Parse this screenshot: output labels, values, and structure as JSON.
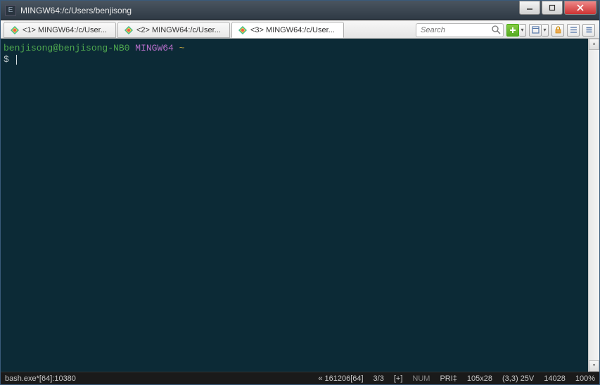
{
  "window": {
    "title": "MINGW64:/c/Users/benjisong"
  },
  "tabs": [
    {
      "label": "<1> MINGW64:/c/User...",
      "active": false
    },
    {
      "label": "<2> MINGW64:/c/User...",
      "active": false
    },
    {
      "label": "<3> MINGW64:/c/User...",
      "active": true
    }
  ],
  "search": {
    "placeholder": "Search"
  },
  "terminal": {
    "prompt_user_host": "benjisong@benjisong-NB0",
    "prompt_env": "MINGW64",
    "prompt_path": "~",
    "prompt_symbol": "$"
  },
  "statusbar": {
    "process": "bash.exe*[64]:10380",
    "encoding": "« 161206[64]",
    "screens": "3/3",
    "plus": "[+]",
    "num": "NUM",
    "pri": "PRI‡",
    "size": "105x28",
    "cursor": "(3,3) 25V",
    "pid": "14028",
    "zoom": "100%"
  }
}
